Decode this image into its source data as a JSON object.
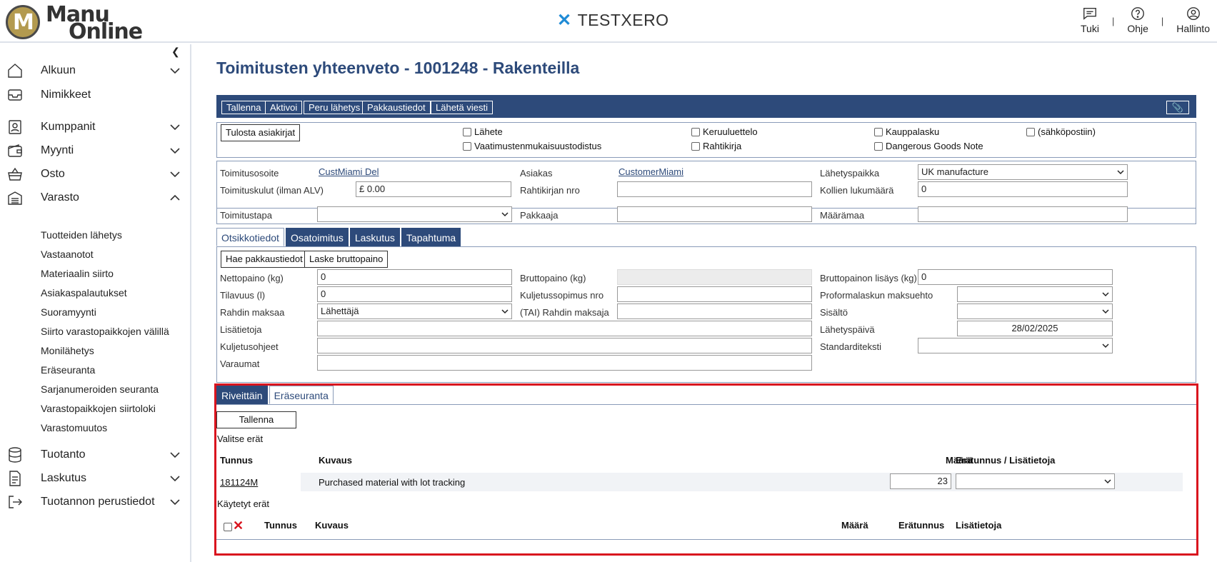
{
  "header": {
    "logo_line1": "Manu",
    "logo_line2": "Online",
    "company": "TESTXERO",
    "nav": [
      {
        "label": "Tuki",
        "icon": "chat-icon"
      },
      {
        "label": "Ohje",
        "icon": "help-icon"
      },
      {
        "label": "Hallinto",
        "icon": "user-icon"
      }
    ],
    "separator": "|"
  },
  "sidebar": {
    "items": [
      {
        "label": "Alkuun",
        "icon": "home-icon",
        "expandable": true
      },
      {
        "label": "Nimikkeet",
        "icon": "inbox-icon",
        "expandable": false
      },
      {
        "label": "Kumppanit",
        "icon": "contacts-icon",
        "expandable": true
      },
      {
        "label": "Myynti",
        "icon": "wallet-icon",
        "expandable": true
      },
      {
        "label": "Osto",
        "icon": "basket-icon",
        "expandable": true
      },
      {
        "label": "Varasto",
        "icon": "warehouse-icon",
        "expandable": true,
        "expanded": true
      },
      {
        "label": "Tuotanto",
        "icon": "database-icon",
        "expandable": true
      },
      {
        "label": "Laskutus",
        "icon": "invoice-icon",
        "expandable": true
      },
      {
        "label": "Tuotannon perustiedot",
        "icon": "signout-icon",
        "expandable": true
      }
    ],
    "varasto_sub": [
      "Tuotteiden lähetys",
      "Vastaanotot",
      "Materiaalin siirto",
      "Asiakaspalautukset",
      "Suoramyynti",
      "Siirto varastopaikkojen välillä",
      "Monilähetys",
      "Eräseuranta",
      "Sarjanumeroiden seuranta",
      "Varastopaikkojen siirtoloki",
      "Varastomuutos"
    ]
  },
  "page": {
    "title": "Toimitusten yhteenveto - 1001248 - Rakenteilla",
    "toolbar": [
      "Tallenna",
      "Aktivoi",
      "Peru lähetys",
      "Pakkaustiedot",
      "Lähetä viesti"
    ],
    "print_button": "Tulosta asiakirjat",
    "print_checks": [
      "Lähete",
      "Vaatimustenmukaisuustodistus",
      "Keruuluettelo",
      "Rahtikirja",
      "Kauppalasku",
      "Dangerous Goods Note",
      "(sähköpostiin)"
    ],
    "fields": {
      "toimitusosoite_label": "Toimitusosoite",
      "toimitusosoite_value": "CustMiami Del",
      "asiakas_label": "Asiakas",
      "asiakas_value": "CustomerMiami",
      "lahetyspaikka_label": "Lähetyspaikka",
      "lahetyspaikka_value": "UK manufacture",
      "toimituskulut_label": "Toimituskulut (ilman ALV)",
      "toimituskulut_value": "£ 0.00",
      "rahtikirjan_label": "Rahtikirjan nro",
      "rahtikirjan_value": "",
      "kollien_label": "Kollien lukumäärä",
      "kollien_value": "0",
      "toimitustapa_label": "Toimitustapa",
      "toimitustapa_value": "",
      "pakkaaja_label": "Pakkaaja",
      "pakkaaja_value": "",
      "maaramaa_label": "Määrämaa",
      "maaramaa_value": ""
    },
    "tabs": [
      "Otsikkotiedot",
      "Osatoimitus",
      "Laskutus",
      "Tapahtuma"
    ],
    "header_tab": {
      "btn_fetch": "Hae pakkaustiedot",
      "btn_calc": "Laske bruttopaino",
      "nettopaino_label": "Nettopaino (kg)",
      "nettopaino_value": "0",
      "bruttopaino_label": "Bruttopaino (kg)",
      "bruttopaino_lisays_label": "Bruttopainon lisäys (kg)",
      "bruttopaino_lisays_value": "0",
      "tilavuus_label": "Tilavuus (l)",
      "tilavuus_value": "0",
      "kuljetussopimus_label": "Kuljetussopimus nro",
      "proforma_label": "Proformalaskun maksuehto",
      "rahdin_maksaa_label": "Rahdin maksaa",
      "rahdin_maksaa_value": "Lähettäjä",
      "tai_rahdin_label": "(TAI) Rahdin maksaja",
      "sisalto_label": "Sisältö",
      "lisatietoja_label": "Lisätietoja",
      "lahetyspaiva_label": "Lähetyspäivä",
      "lahetyspaiva_value": "28/02/2025",
      "kuljetusohjeet_label": "Kuljetusohjeet",
      "standarditeksti_label": "Standarditeksti",
      "varaumat_label": "Varaumat"
    },
    "lot_tabs": [
      "Riveittäin",
      "Eräseuranta"
    ],
    "lot": {
      "save": "Tallenna",
      "select_lots": "Valitse erät",
      "col_tunnus": "Tunnus",
      "col_kuvaus": "Kuvaus",
      "col_maara": "Määrä",
      "col_eratunnus_lisa": "Erätunnus / Lisätietoja",
      "rows": [
        {
          "tunnus": "181124M",
          "kuvaus": "Purchased material with lot tracking",
          "maara": "23",
          "eratunnus": ""
        }
      ],
      "used_lots": "Käytetyt erät",
      "used_col_tunnus": "Tunnus",
      "used_col_kuvaus": "Kuvaus",
      "used_col_maara": "Määrä",
      "used_col_eratunnus": "Erätunnus",
      "used_col_lisatietoja": "Lisätietoja"
    }
  },
  "colors": {
    "primary": "#2d4a7a",
    "highlight": "#d9141e",
    "brand": "#b39a4f"
  }
}
